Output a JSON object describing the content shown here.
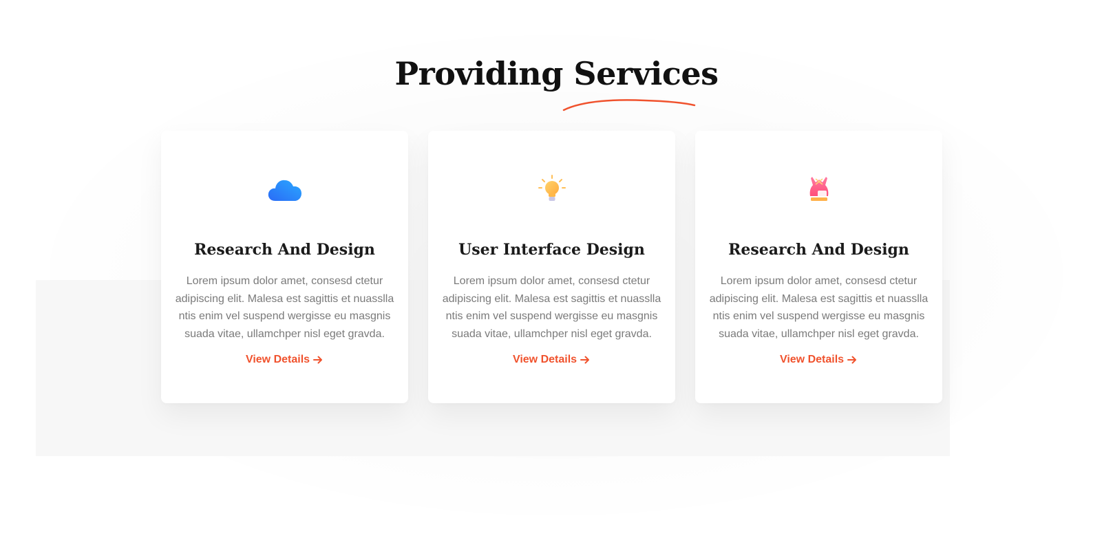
{
  "section": {
    "title": "Providing Services",
    "accent_color": "#f0522d"
  },
  "cards": [
    {
      "icon": "cloud-icon",
      "title": "Research And Design",
      "text": "Lorem ipsum dolor amet, consesd ctetur adipiscing elit. Malesa est sagittis et nuasslla ntis enim vel suspend wergisse eu masgnis suada vitae, ullamchper nisl eget gravda.",
      "link_label": "View Details"
    },
    {
      "icon": "lightbulb-icon",
      "title": "User Interface Design",
      "text": "Lorem ipsum dolor amet, consesd ctetur adipiscing elit. Malesa est sagittis et nuasslla ntis enim vel suspend wergisse eu masgnis suada vitae, ullamchper nisl eget gravda.",
      "link_label": "View Details"
    },
    {
      "icon": "dress-icon",
      "title": "Research And Design",
      "text": "Lorem ipsum dolor amet, consesd ctetur adipiscing elit. Malesa est sagittis et nuasslla ntis enim vel suspend wergisse eu masgnis suada vitae, ullamchper nisl eget gravda.",
      "link_label": "View Details"
    }
  ]
}
